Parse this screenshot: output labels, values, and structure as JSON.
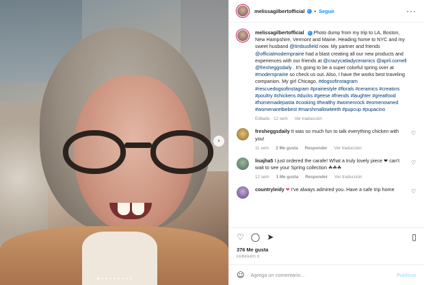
{
  "header": {
    "username": "melissagilbertofficial",
    "separator": "•",
    "follow_label": "Seguir",
    "more_icon": "more-horizontal-icon"
  },
  "caption": {
    "username": "melissagilbertofficial",
    "text_1": "Photo dump from my trip to LA, Boston, New Hampshire, Vermont and Maine. Heading home to NYC and my sweet husband ",
    "mention_1": "@timbusfield",
    "text_2": " now. My partner and friends ",
    "mention_2": "@officialmodernprairie",
    "text_3": " had a blast creating all our new products and experiences with our friends at ",
    "mention_3": "@crazycatladyceramics",
    "mention_4": "@april.cornell",
    "mention_5": "@fresheggsdaily",
    "text_4": " . It's going to be a super colorful spring over at ",
    "mention_6": "#modernprairie",
    "text_5": " so check us out. Also, I have the works best traveling companion. My girl Chicago.",
    "hashtags": "#dogsofinstagram #rescuedogsofinstagram #prairiestyle #florals #ceramics #creators #poultry #chickens #ducks #geese #friends #laughter #greatfood #homemadepasta #cooking #healthy #womenrock #eomenowned #womenaretbebest #marshmallowteeth #pupcup #pupacino",
    "edited": "Editado · 12 sem",
    "see_translation": "Ver traducción"
  },
  "comments": [
    {
      "username": "fresheggsdaily",
      "text": "It was so much fun to talk everything chicken with you!",
      "time": "11 sem",
      "likes": "2 Me gusta",
      "reply": "Responder",
      "translate": "Ver traducción"
    },
    {
      "username": "lisajha5",
      "text": "I just ordered the carafe! What a truly lovely piece ❤ can't wait to see your Spring collection ☘☘☘",
      "time": "12 sem",
      "likes": "1 Me gusta",
      "reply": "Responder",
      "translate": "Ver traducción"
    },
    {
      "username": "countryleidy",
      "text": "I've always admired you. Have a safe trip home",
      "heart": "❤"
    }
  ],
  "actions": {
    "like_icon": "heart-outline-icon",
    "comment_icon": "comment-icon",
    "share_icon": "share-icon",
    "save_icon": "bookmark-icon"
  },
  "likes": "376 Me gusta",
  "date": "FEBRERO 8",
  "add_comment": {
    "placeholder": "Agrega un comentario...",
    "post_label": "Publicar",
    "emoji_icon": "smile-icon"
  },
  "colors": {
    "accent": "#0095f6",
    "verified": "#3897f0",
    "link": "#00376b",
    "muted": "#8e8e8e"
  }
}
